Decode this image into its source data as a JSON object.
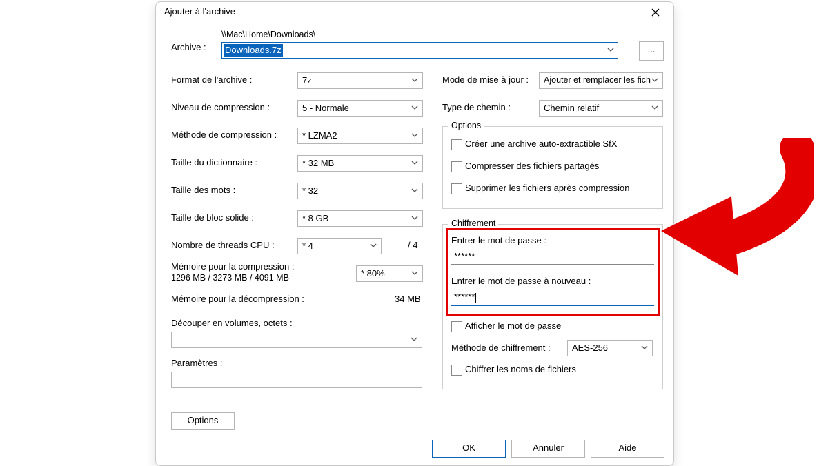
{
  "window": {
    "title": "Ajouter à l'archive"
  },
  "archive": {
    "label": "Archive :",
    "path": "\\\\Mac\\Home\\Downloads\\",
    "filename": "Downloads.7z",
    "browse": "..."
  },
  "left": {
    "format": {
      "label": "Format de l'archive :",
      "value": "7z"
    },
    "level": {
      "label": "Niveau de compression :",
      "value": "5 - Normale"
    },
    "method": {
      "label": "Méthode de compression :",
      "value": "* LZMA2"
    },
    "dict": {
      "label": "Taille du dictionnaire :",
      "value": "* 32 MB"
    },
    "word": {
      "label": "Taille des mots :",
      "value": "* 32"
    },
    "block": {
      "label": "Taille de bloc solide :",
      "value": "* 8 GB"
    },
    "threads": {
      "label": "Nombre de threads CPU :",
      "value": "* 4",
      "max": "/ 4"
    },
    "mem_comp": {
      "label": "Mémoire pour la compression :",
      "meta": "1296 MB / 3273 MB / 4091 MB",
      "value": "* 80%"
    },
    "mem_decomp": {
      "label": "Mémoire pour la décompression :",
      "value": "34 MB"
    },
    "split": {
      "label": "Découper en volumes, octets :"
    },
    "params": {
      "label": "Paramètres :"
    }
  },
  "right": {
    "update": {
      "label": "Mode de mise à jour :",
      "value": "Ajouter et remplacer les fich"
    },
    "pathmode": {
      "label": "Type de chemin :",
      "value": "Chemin relatif"
    },
    "options": {
      "legend": "Options",
      "sfx": "Créer une archive auto-extractible SfX",
      "shared": "Compresser des fichiers partagés",
      "delete": "Supprimer les fichiers après compression"
    },
    "enc": {
      "legend": "Chiffrement",
      "pw1_label": "Entrer le mot de passe :",
      "pw1_value": "******",
      "pw2_label": "Entrer le mot de passe à nouveau :",
      "pw2_value": "******",
      "show": "Afficher le mot de passe",
      "method_label": "Méthode de chiffrement :",
      "method_value": "AES-256",
      "names": "Chiffrer les noms de fichiers"
    }
  },
  "buttons": {
    "options": "Options",
    "ok": "OK",
    "cancel": "Annuler",
    "help": "Aide"
  }
}
